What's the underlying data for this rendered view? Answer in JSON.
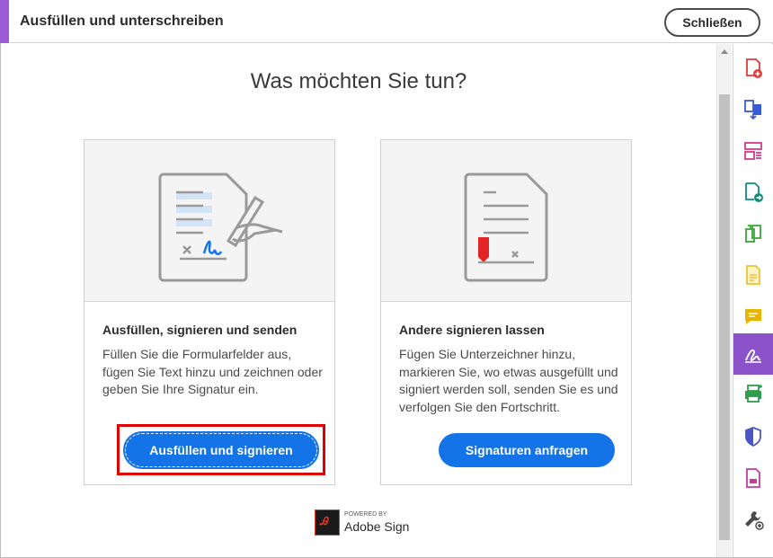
{
  "topbar": {
    "title": "Ausfüllen und unterschreiben",
    "close_label": "Schließen"
  },
  "main": {
    "heading": "Was möchten Sie tun?",
    "cards": [
      {
        "title": "Ausfüllen, signieren und senden",
        "description": "Füllen Sie die Formularfelder aus, fügen Sie Text hinzu und zeichnen oder geben Sie Ihre Signatur ein.",
        "button_label": "Ausfüllen und signieren"
      },
      {
        "title": "Andere signieren lassen",
        "description": "Fügen Sie Unterzeichner hinzu, markieren Sie, wo etwas ausgefüllt und signiert werden soll, senden Sie es und verfolgen Sie den Fortschritt.",
        "button_label": "Signaturen anfragen"
      }
    ],
    "powered_by": "POWERED BY",
    "brand": "Adobe Sign"
  },
  "rail": {
    "tools": [
      {
        "icon": "create-pdf-icon",
        "color": "#e03a3a"
      },
      {
        "icon": "combine-files-icon",
        "color": "#3a5bd6"
      },
      {
        "icon": "organize-pages-icon",
        "color": "#d63a8a"
      },
      {
        "icon": "export-pdf-icon",
        "color": "#0e8f7e"
      },
      {
        "icon": "scan-icon",
        "color": "#3aa83a"
      },
      {
        "icon": "edit-pdf-icon",
        "color": "#e8c43a"
      },
      {
        "icon": "comment-icon",
        "color": "#e8b400"
      },
      {
        "icon": "fill-sign-icon",
        "color": "#ffffff"
      },
      {
        "icon": "print-production-icon",
        "color": "#2e9e4e"
      },
      {
        "icon": "protect-icon",
        "color": "#4a55c8"
      },
      {
        "icon": "request-signatures-icon",
        "color": "#c83a9e"
      },
      {
        "icon": "more-tools-icon",
        "color": "#4a4a4a"
      }
    ]
  },
  "colors": {
    "accent": "#9b5ad6",
    "primary_button": "#1473e6",
    "highlight": "#e00000",
    "active_tool": "#8c52c9"
  }
}
